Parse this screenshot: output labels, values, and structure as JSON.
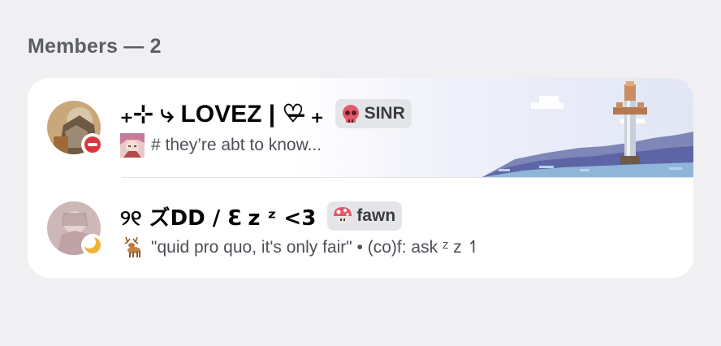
{
  "section": {
    "header": "Members — 2"
  },
  "members": [
    {
      "display_name": "₊⊹ ⤷ LOVEZ | ♡̶ ₊",
      "tag": "SINR",
      "tag_icon": "skull-icon",
      "status": "dnd",
      "status_icon": "do-not-disturb-icon",
      "custom_status": "# they’re abt to know...",
      "custom_status_emoji": "anime-character-emoji",
      "has_banner": true
    },
    {
      "display_name": "୨୧ ズDD / ℇ z ᶻ <3",
      "tag": "fawn",
      "tag_icon": "mushroom-icon",
      "status": "idle",
      "status_icon": "moon-icon",
      "custom_status": "\"quid pro quo, it's only fair\" • (co)f: ask ᶻ z ↿",
      "custom_status_emoji": "deer-emoji",
      "has_banner": false
    }
  ],
  "colors": {
    "dnd": "#da373c",
    "idle": "#f0b232",
    "tag_background": "#e4e5e9"
  }
}
